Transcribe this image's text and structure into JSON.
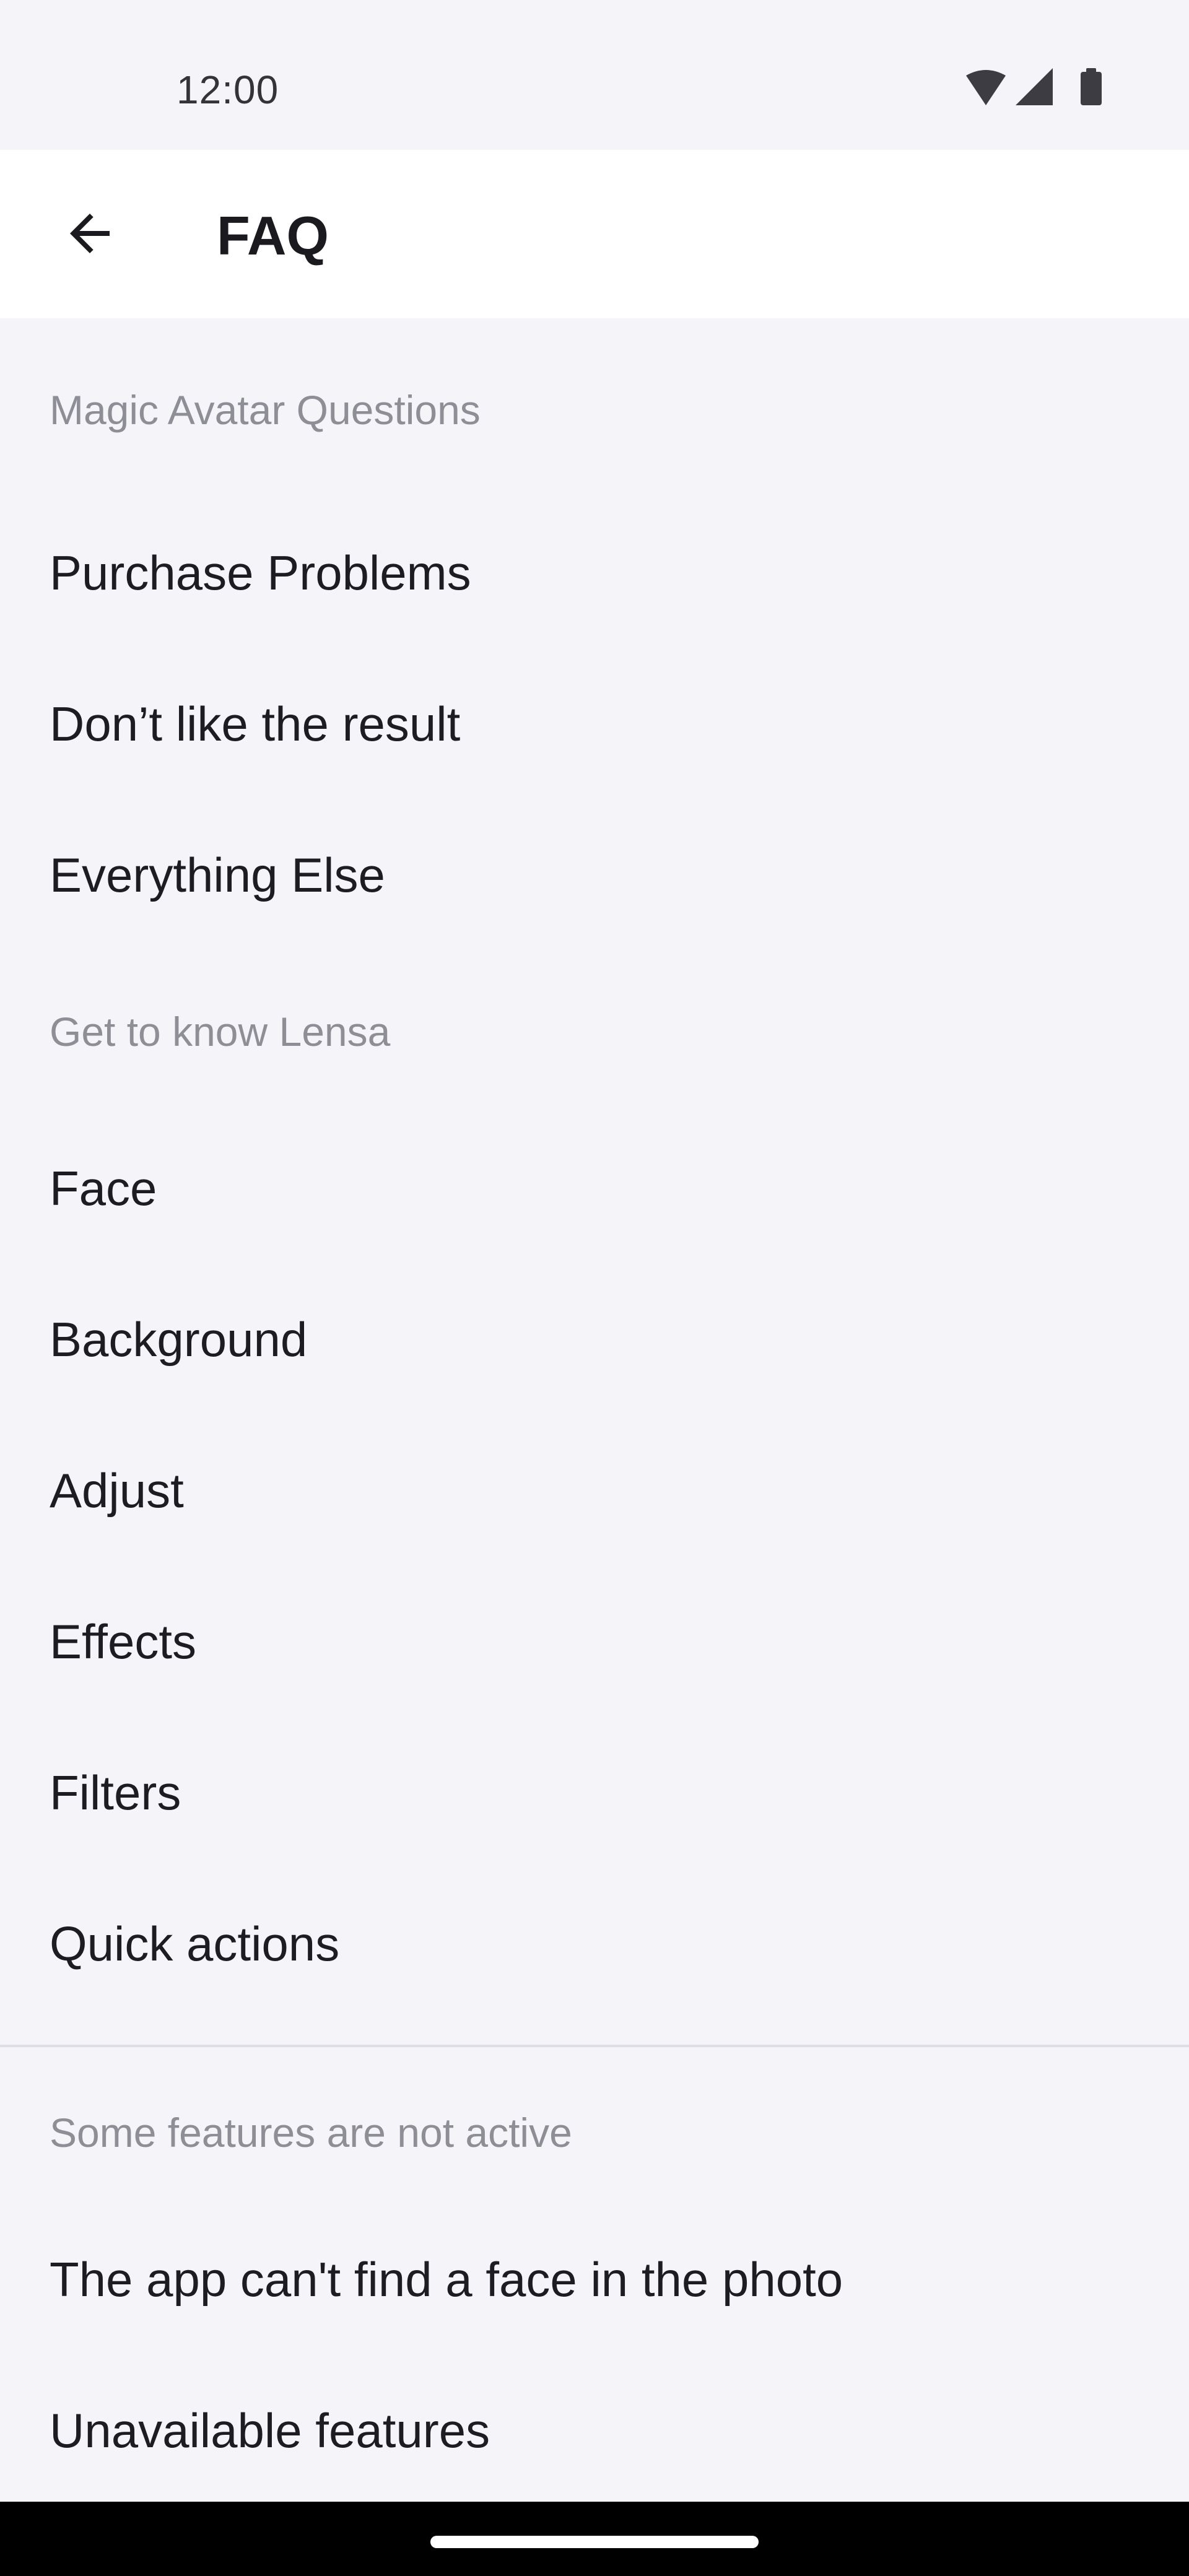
{
  "status_bar": {
    "time": "12:00",
    "icons": [
      "wifi-icon",
      "cellular-signal-icon",
      "battery-icon"
    ]
  },
  "app_bar": {
    "back_icon": "arrow-left-icon",
    "title": "FAQ"
  },
  "sections": [
    {
      "header": "Magic Avatar Questions",
      "items": [
        {
          "label": "Purchase Problems"
        },
        {
          "label": "Don’t like the result"
        },
        {
          "label": "Everything Else"
        }
      ]
    },
    {
      "header": "Get to know Lensa",
      "items": [
        {
          "label": "Face"
        },
        {
          "label": "Background"
        },
        {
          "label": "Adjust"
        },
        {
          "label": "Effects"
        },
        {
          "label": "Filters"
        },
        {
          "label": "Quick actions"
        }
      ]
    },
    {
      "header": "Some features are not active",
      "items": [
        {
          "label": "The app can't find a face in the photo"
        },
        {
          "label": "Unavailable features"
        }
      ]
    }
  ],
  "colors": {
    "background": "#f4f4f9",
    "app_bar": "#ffffff",
    "text_primary": "#1c1c22",
    "text_secondary": "#8e8e96",
    "nav_bar": "#000000"
  }
}
